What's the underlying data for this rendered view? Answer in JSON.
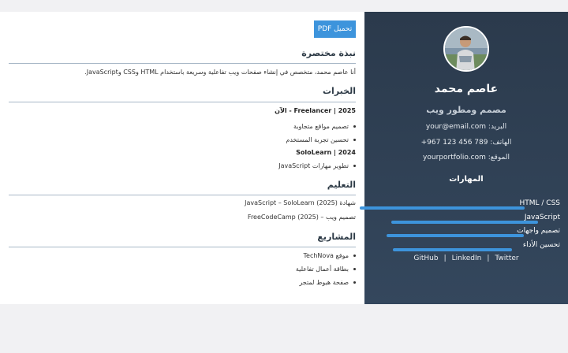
{
  "sidebar": {
    "name": "عاصم محمد",
    "role": "مصمم ومطور ويب",
    "contacts": [
      {
        "key": "البريد:",
        "value": "your@email.com"
      },
      {
        "key": "الهاتف:",
        "value": "+967 123 456 789"
      },
      {
        "key": "الموقع:",
        "value": "yourportfolio.com"
      }
    ],
    "skills_title": "المهارات",
    "skills": [
      {
        "label": "HTML / CSS",
        "level": 0.9
      },
      {
        "label": "JavaScript",
        "level": 0.8
      },
      {
        "label": "تصميم واجهات",
        "level": 0.75
      },
      {
        "label": "تحسين الأداء",
        "level": 0.65
      }
    ],
    "links": [
      "GitHub",
      "LinkedIn",
      "Twitter"
    ]
  },
  "main": {
    "pdf_button": "تحميل PDF",
    "about": {
      "title": "نبذة مختصرة",
      "text": "أنا عاصم محمد، متخصص في إنشاء صفحات ويب تفاعلية وسريعة باستخدام HTML وCSS وJavaScript."
    },
    "experience": {
      "title": "الخبرات",
      "jobs": [
        {
          "heading": "2025 | Freelancer - الآن",
          "items": [
            "تصميم مواقع متجاوبة",
            "تحسين تجربة المستخدم"
          ]
        },
        {
          "heading": "2024 | SoloLearn",
          "items": [
            "تطوير مهارات JavaScript"
          ]
        }
      ]
    },
    "education": {
      "title": "التعليم",
      "items": [
        "شهادة JavaScript – SoloLearn (2025)",
        "تصميم ويب – FreeCodeCamp (2025)"
      ]
    },
    "projects": {
      "title": "المشاريع",
      "items": [
        "موقع TechNova",
        "بطاقة أعمال تفاعلية",
        "صفحة هبوط لمتجر"
      ]
    }
  },
  "colors": {
    "sidebar_bg": "#2b3a4c",
    "accent": "#3d94dc",
    "rule": "#a8b8c7"
  }
}
